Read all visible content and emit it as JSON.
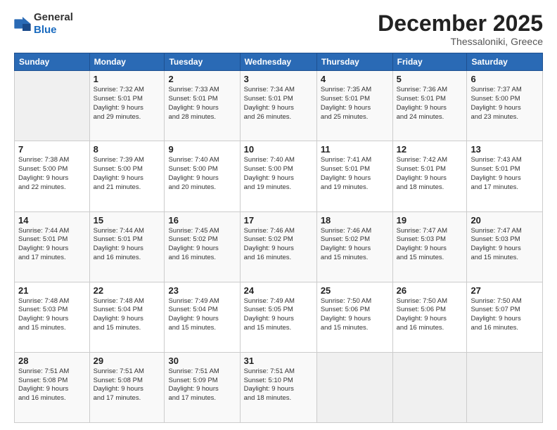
{
  "header": {
    "logo_general": "General",
    "logo_blue": "Blue",
    "month_title": "December 2025",
    "location": "Thessaloniki, Greece"
  },
  "days_of_week": [
    "Sunday",
    "Monday",
    "Tuesday",
    "Wednesday",
    "Thursday",
    "Friday",
    "Saturday"
  ],
  "weeks": [
    [
      {
        "day": "",
        "info": ""
      },
      {
        "day": "1",
        "info": "Sunrise: 7:32 AM\nSunset: 5:01 PM\nDaylight: 9 hours\nand 29 minutes."
      },
      {
        "day": "2",
        "info": "Sunrise: 7:33 AM\nSunset: 5:01 PM\nDaylight: 9 hours\nand 28 minutes."
      },
      {
        "day": "3",
        "info": "Sunrise: 7:34 AM\nSunset: 5:01 PM\nDaylight: 9 hours\nand 26 minutes."
      },
      {
        "day": "4",
        "info": "Sunrise: 7:35 AM\nSunset: 5:01 PM\nDaylight: 9 hours\nand 25 minutes."
      },
      {
        "day": "5",
        "info": "Sunrise: 7:36 AM\nSunset: 5:01 PM\nDaylight: 9 hours\nand 24 minutes."
      },
      {
        "day": "6",
        "info": "Sunrise: 7:37 AM\nSunset: 5:00 PM\nDaylight: 9 hours\nand 23 minutes."
      }
    ],
    [
      {
        "day": "7",
        "info": "Sunrise: 7:38 AM\nSunset: 5:00 PM\nDaylight: 9 hours\nand 22 minutes."
      },
      {
        "day": "8",
        "info": "Sunrise: 7:39 AM\nSunset: 5:00 PM\nDaylight: 9 hours\nand 21 minutes."
      },
      {
        "day": "9",
        "info": "Sunrise: 7:40 AM\nSunset: 5:00 PM\nDaylight: 9 hours\nand 20 minutes."
      },
      {
        "day": "10",
        "info": "Sunrise: 7:40 AM\nSunset: 5:00 PM\nDaylight: 9 hours\nand 19 minutes."
      },
      {
        "day": "11",
        "info": "Sunrise: 7:41 AM\nSunset: 5:01 PM\nDaylight: 9 hours\nand 19 minutes."
      },
      {
        "day": "12",
        "info": "Sunrise: 7:42 AM\nSunset: 5:01 PM\nDaylight: 9 hours\nand 18 minutes."
      },
      {
        "day": "13",
        "info": "Sunrise: 7:43 AM\nSunset: 5:01 PM\nDaylight: 9 hours\nand 17 minutes."
      }
    ],
    [
      {
        "day": "14",
        "info": "Sunrise: 7:44 AM\nSunset: 5:01 PM\nDaylight: 9 hours\nand 17 minutes."
      },
      {
        "day": "15",
        "info": "Sunrise: 7:44 AM\nSunset: 5:01 PM\nDaylight: 9 hours\nand 16 minutes."
      },
      {
        "day": "16",
        "info": "Sunrise: 7:45 AM\nSunset: 5:02 PM\nDaylight: 9 hours\nand 16 minutes."
      },
      {
        "day": "17",
        "info": "Sunrise: 7:46 AM\nSunset: 5:02 PM\nDaylight: 9 hours\nand 16 minutes."
      },
      {
        "day": "18",
        "info": "Sunrise: 7:46 AM\nSunset: 5:02 PM\nDaylight: 9 hours\nand 15 minutes."
      },
      {
        "day": "19",
        "info": "Sunrise: 7:47 AM\nSunset: 5:03 PM\nDaylight: 9 hours\nand 15 minutes."
      },
      {
        "day": "20",
        "info": "Sunrise: 7:47 AM\nSunset: 5:03 PM\nDaylight: 9 hours\nand 15 minutes."
      }
    ],
    [
      {
        "day": "21",
        "info": "Sunrise: 7:48 AM\nSunset: 5:03 PM\nDaylight: 9 hours\nand 15 minutes."
      },
      {
        "day": "22",
        "info": "Sunrise: 7:48 AM\nSunset: 5:04 PM\nDaylight: 9 hours\nand 15 minutes."
      },
      {
        "day": "23",
        "info": "Sunrise: 7:49 AM\nSunset: 5:04 PM\nDaylight: 9 hours\nand 15 minutes."
      },
      {
        "day": "24",
        "info": "Sunrise: 7:49 AM\nSunset: 5:05 PM\nDaylight: 9 hours\nand 15 minutes."
      },
      {
        "day": "25",
        "info": "Sunrise: 7:50 AM\nSunset: 5:06 PM\nDaylight: 9 hours\nand 15 minutes."
      },
      {
        "day": "26",
        "info": "Sunrise: 7:50 AM\nSunset: 5:06 PM\nDaylight: 9 hours\nand 16 minutes."
      },
      {
        "day": "27",
        "info": "Sunrise: 7:50 AM\nSunset: 5:07 PM\nDaylight: 9 hours\nand 16 minutes."
      }
    ],
    [
      {
        "day": "28",
        "info": "Sunrise: 7:51 AM\nSunset: 5:08 PM\nDaylight: 9 hours\nand 16 minutes."
      },
      {
        "day": "29",
        "info": "Sunrise: 7:51 AM\nSunset: 5:08 PM\nDaylight: 9 hours\nand 17 minutes."
      },
      {
        "day": "30",
        "info": "Sunrise: 7:51 AM\nSunset: 5:09 PM\nDaylight: 9 hours\nand 17 minutes."
      },
      {
        "day": "31",
        "info": "Sunrise: 7:51 AM\nSunset: 5:10 PM\nDaylight: 9 hours\nand 18 minutes."
      },
      {
        "day": "",
        "info": ""
      },
      {
        "day": "",
        "info": ""
      },
      {
        "day": "",
        "info": ""
      }
    ]
  ]
}
